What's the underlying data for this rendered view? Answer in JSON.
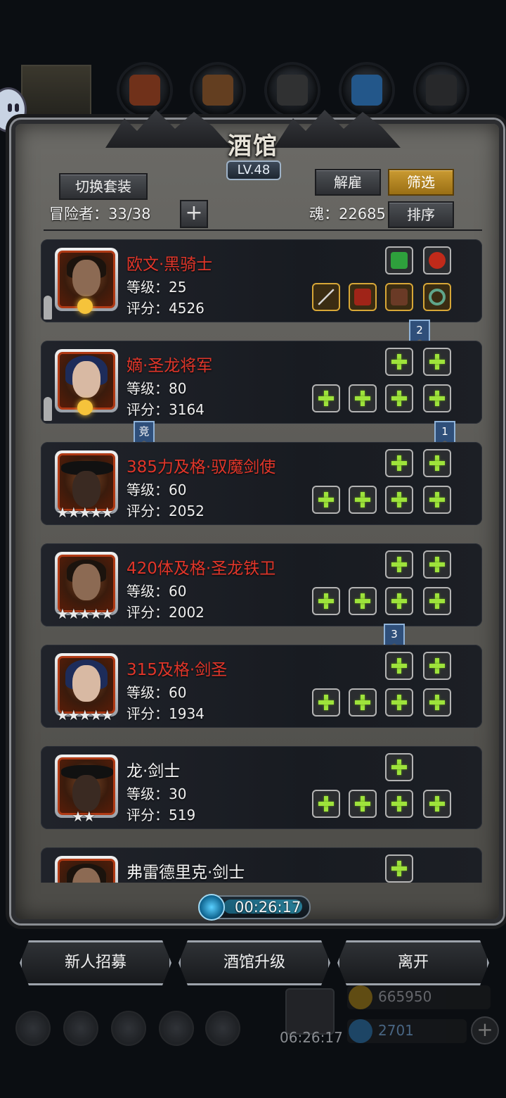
{
  "panel": {
    "title": "酒馆",
    "level": "LV.48",
    "switch_button": "切换套装",
    "dismiss_button": "解雇",
    "filter_button": "筛选",
    "sort_button": "排序",
    "adventurer_label": "冒险者：33/38",
    "soul_label": "魂：22685"
  },
  "heroes": [
    {
      "name": "欧文·黑骑士",
      "level": "等级：25",
      "score": "评分：4526",
      "stars": ""
    },
    {
      "name": "嫡·圣龙将军",
      "level": "等级：80",
      "score": "评分：3164",
      "stars": ""
    },
    {
      "name": "385力及格·驭魔剑使",
      "level": "等级：60",
      "score": "评分：2052",
      "stars": "★★★★★"
    },
    {
      "name": "420体及格·圣龙铁卫",
      "level": "等级：60",
      "score": "评分：2002",
      "stars": "★★★★★"
    },
    {
      "name": "315及格·剑圣",
      "level": "等级：60",
      "score": "评分：1934",
      "stars": "★★★★★"
    },
    {
      "name": "龙·剑士",
      "level": "等级：30",
      "score": "评分：519",
      "stars": "★★"
    },
    {
      "name": "弗雷德里克·剑士"
    }
  ],
  "ribbons": {
    "r2": "2",
    "r_jing": "竞",
    "r1": "1",
    "r3": "3"
  },
  "timer": "00:26:17",
  "buttons": {
    "recruit": "新人招募",
    "upgrade": "酒馆升级",
    "leave": "离开"
  },
  "footer": {
    "time": "06:26:17",
    "gold": "665950",
    "gems": "2701"
  },
  "colors": {
    "accent_gold": "#c99a32",
    "name_red": "#e0362a",
    "plus_green": "#9ee33b"
  }
}
